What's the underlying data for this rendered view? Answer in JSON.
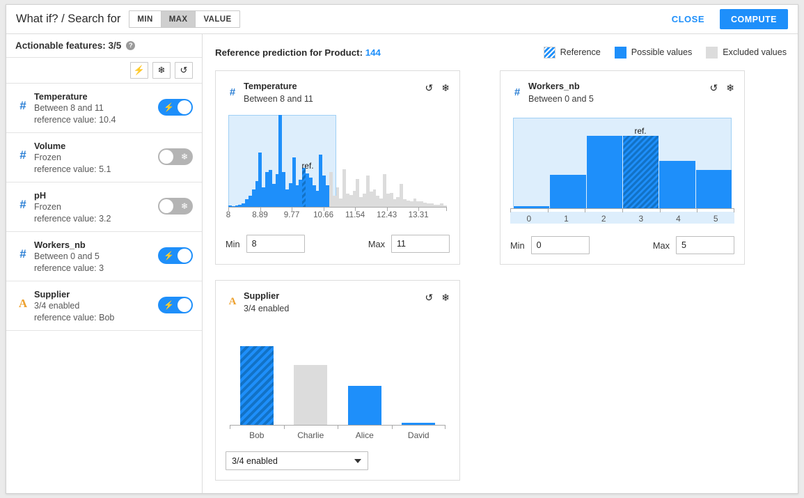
{
  "header": {
    "title": "What if? / Search for",
    "modes": [
      {
        "label": "MIN",
        "active": false
      },
      {
        "label": "MAX",
        "active": true
      },
      {
        "label": "VALUE",
        "active": false
      }
    ],
    "close_label": "CLOSE",
    "compute_label": "COMPUTE"
  },
  "sidebar": {
    "heading": "Actionable features: 3/5",
    "help_glyph": "?",
    "tools": [
      {
        "name": "enable-all",
        "glyph": "⚡"
      },
      {
        "name": "freeze-all",
        "glyph": "❄"
      },
      {
        "name": "reset-all",
        "glyph": "↺"
      }
    ],
    "features": [
      {
        "name": "Temperature",
        "type": "#",
        "type_kind": "num",
        "sub": "Between 8 and 11",
        "ref": "reference value: 10.4",
        "state": "on",
        "glyph": "⚡"
      },
      {
        "name": "Volume",
        "type": "#",
        "type_kind": "num",
        "sub": "Frozen",
        "ref": "reference value: 5.1",
        "state": "off",
        "glyph": "❄"
      },
      {
        "name": "pH",
        "type": "#",
        "type_kind": "num",
        "sub": "Frozen",
        "ref": "reference value: 3.2",
        "state": "off",
        "glyph": "❄"
      },
      {
        "name": "Workers_nb",
        "type": "#",
        "type_kind": "num",
        "sub": "Between 0 and 5",
        "ref": "reference value: 3",
        "state": "on",
        "glyph": "⚡"
      },
      {
        "name": "Supplier",
        "type": "A",
        "type_kind": "cat",
        "sub": "3/4 enabled",
        "ref": "reference value: Bob",
        "state": "on",
        "glyph": "⚡"
      }
    ]
  },
  "main": {
    "title_prefix": "Reference prediction for Product:",
    "title_value": "144",
    "legend": [
      {
        "label": "Reference",
        "style": "hatch"
      },
      {
        "label": "Possible values",
        "style": "solid"
      },
      {
        "label": "Excluded values",
        "style": "gray"
      }
    ],
    "reset_glyph": "↺",
    "freeze_glyph": "❄",
    "ref_tag": "ref."
  },
  "colors": {
    "accent": "#1e8ffa",
    "excluded": "#dcdcdc",
    "band": "#ddeefc",
    "band_border": "#9fd0f5",
    "numeric_icon": "#2b7fd4",
    "categorical_icon": "#eda12f"
  },
  "chart_data": [
    {
      "type": "bar",
      "name": "Temperature",
      "title": "Temperature",
      "subtitle": "Between 8 and 11",
      "xlabel": "",
      "ylabel": "",
      "tick_labels": [
        "8",
        "8.89",
        "9.77",
        "10.66",
        "11.54",
        "12.43",
        "13.31"
      ],
      "tick_positions": [
        0.0,
        0.145,
        0.29,
        0.435,
        0.58,
        0.725,
        0.87
      ],
      "selection": {
        "min": 8,
        "max": 11,
        "band_start_frac": 0.0,
        "band_end_frac": 0.495
      },
      "reference_value": 10.4,
      "reference_bin_index": 22,
      "ref_annotation": "ref.",
      "values": [
        1,
        0,
        1,
        2,
        3,
        7,
        10,
        16,
        24,
        50,
        18,
        32,
        34,
        21,
        30,
        85,
        32,
        16,
        22,
        46,
        20,
        25,
        36,
        31,
        27,
        20,
        15,
        48,
        29,
        20,
        32,
        10,
        18,
        8,
        35,
        12,
        11,
        15,
        26,
        9,
        12,
        29,
        14,
        16,
        10,
        8,
        30,
        12,
        13,
        7,
        9,
        21,
        7,
        6,
        5,
        8,
        5,
        5,
        4,
        3,
        3,
        2,
        2,
        3,
        1
      ],
      "bar_states": [
        "inc",
        "inc",
        "inc",
        "inc",
        "inc",
        "inc",
        "inc",
        "inc",
        "inc",
        "inc",
        "inc",
        "inc",
        "inc",
        "inc",
        "inc",
        "inc",
        "inc",
        "inc",
        "inc",
        "inc",
        "inc",
        "inc",
        "ref",
        "inc",
        "inc",
        "inc",
        "inc",
        "inc",
        "inc",
        "inc",
        "exc",
        "exc",
        "exc",
        "exc",
        "exc",
        "exc",
        "exc",
        "exc",
        "exc",
        "exc",
        "exc",
        "exc",
        "exc",
        "exc",
        "exc",
        "exc",
        "exc",
        "exc",
        "exc",
        "exc",
        "exc",
        "exc",
        "exc",
        "exc",
        "exc",
        "exc",
        "exc",
        "exc",
        "exc",
        "exc",
        "exc",
        "exc",
        "exc",
        "exc",
        "exc"
      ],
      "inputs": {
        "min_label": "Min",
        "min_value": "8",
        "max_label": "Max",
        "max_value": "11"
      }
    },
    {
      "type": "bar",
      "name": "Workers_nb",
      "title": "Workers_nb",
      "subtitle": "Between 0 and 5",
      "xlabel": "",
      "ylabel": "",
      "categories": [
        "0",
        "1",
        "2",
        "3",
        "4",
        "5"
      ],
      "values": [
        2,
        35,
        76,
        76,
        50,
        40
      ],
      "bar_states": [
        "inc",
        "inc",
        "inc",
        "ref",
        "inc",
        "inc"
      ],
      "reference_value": 3,
      "ref_annotation": "ref.",
      "selection": {
        "min": 0,
        "max": 5
      },
      "inputs": {
        "min_label": "Min",
        "min_value": "0",
        "max_label": "Max",
        "max_value": "5"
      }
    },
    {
      "type": "bar",
      "name": "Supplier",
      "title": "Supplier",
      "subtitle": "3/4 enabled",
      "xlabel": "",
      "ylabel": "",
      "categories": [
        "Bob",
        "Charlie",
        "Alice",
        "David"
      ],
      "values": [
        100,
        76,
        50,
        2
      ],
      "bar_states": [
        "ref",
        "exc",
        "inc",
        "inc"
      ],
      "reference_value": "Bob",
      "select_value": "3/4 enabled"
    }
  ]
}
